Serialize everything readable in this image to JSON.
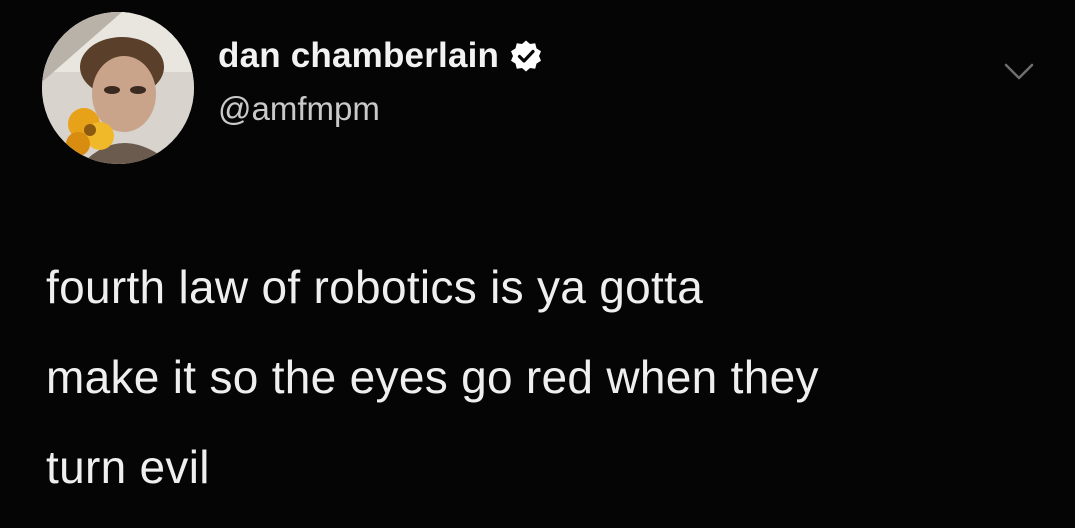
{
  "tweet": {
    "author": {
      "display_name": "dan chamberlain",
      "handle": "@amfmpm",
      "verified": true,
      "avatar_icon": "profile-photo-avatar"
    },
    "text_lines": [
      "fourth law of robotics is ya gotta",
      "make it so the eyes go red when they",
      "turn evil"
    ],
    "menu_icon": "chevron-down-icon"
  },
  "colors": {
    "background": "#050505",
    "name_text": "#f2f2f2",
    "handle_text": "#c9c9c9",
    "body_text": "#efefef",
    "verified_badge": "#ffffff"
  }
}
